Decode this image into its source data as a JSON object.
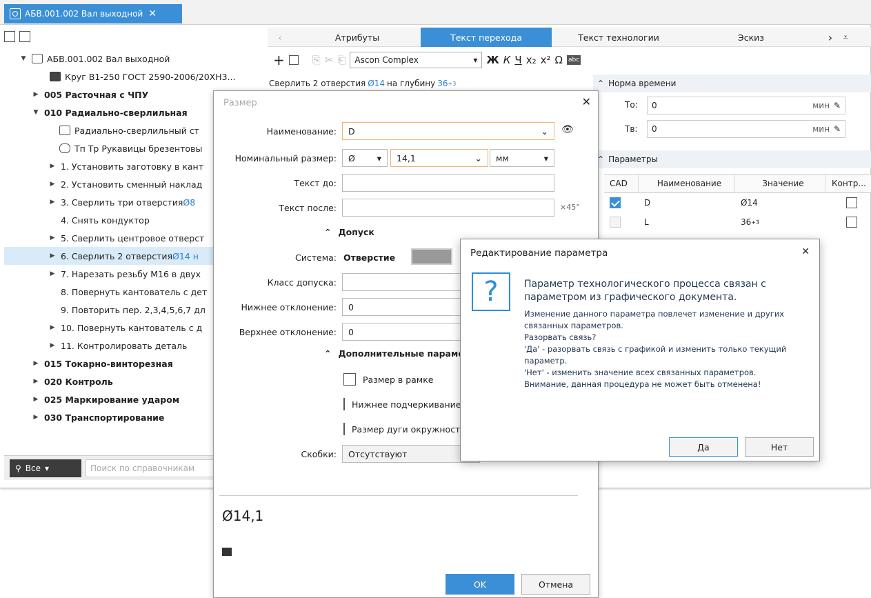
{
  "doc_tab": {
    "title": "АБВ.001.002 Вал выходной",
    "close": "✕"
  },
  "tree": {
    "root": "АБВ.001.002 Вал выходной",
    "material": "Круг В1-250 ГОСТ 2590-2006/20ХН3...",
    "items": [
      {
        "text": "005 Расточная с ЧПУ",
        "bold": true
      },
      {
        "text": "010 Радиально-сверлильная",
        "bold": true
      },
      {
        "text": "Радиально-сверлильный ст"
      },
      {
        "text": "Тп Тр Рукавицы брезентовы"
      },
      {
        "text": "1. Установить заготовку в кант"
      },
      {
        "text": "2. Установить сменный наклад"
      },
      {
        "text": "3. Сверлить три отверстия ",
        "blue": "Ø8"
      },
      {
        "text": "4. Снять кондуктор"
      },
      {
        "text": "5. Сверлить центровое отверст"
      },
      {
        "text": "6. Сверлить 2 отверстия ",
        "blue": "Ø14 н"
      },
      {
        "text": "7. Нарезать резьбу М16 в двух"
      },
      {
        "text": "8. Повернуть кантователь с дет"
      },
      {
        "text": "9. Повторить пер. 2,3,4,5,6,7 дл"
      },
      {
        "text": "10. Повернуть кантователь с д"
      },
      {
        "text": "11. Контролировать деталь"
      },
      {
        "text": "015 Токарно-винторезная",
        "bold": true
      },
      {
        "text": "020 Контроль",
        "bold": true
      },
      {
        "text": "025 Маркирование ударом",
        "bold": true
      },
      {
        "text": "030 Транспортирование",
        "bold": true
      }
    ],
    "search_scope": "Все",
    "search_placeholder": "Поиск по справочникам"
  },
  "right_tabs": [
    "Атрибуты",
    "Текст перехода",
    "Текст технологии",
    "Эскиз"
  ],
  "toolbar": {
    "font": "Ascon Complex",
    "bold": "Ж",
    "italic": "К",
    "underline": "Ч",
    "sub": "x₂",
    "sup": "x²",
    "omega": "Ω",
    "abc": "abc"
  },
  "transition_text": {
    "prefix": "Сверлить 2 отверстия ",
    "dia": "Ø14",
    "mid": " на глубину ",
    "depth": "36",
    "tol": "+3"
  },
  "norm": {
    "header": "Норма времени",
    "to_label": "То:",
    "to_value": "0",
    "to_unit": "мин",
    "tv_label": "Тв:",
    "tv_value": "0",
    "tv_unit": "мин"
  },
  "params": {
    "header": "Параметры",
    "columns": [
      "CAD",
      "Наименование",
      "Значение",
      "Контр..."
    ],
    "rows": [
      {
        "cad": true,
        "name": "D",
        "value": "Ø14",
        "tol": ""
      },
      {
        "cad": false,
        "name": "L",
        "value": "36",
        "tol": "+3"
      }
    ]
  },
  "size_dialog": {
    "title": "Размер",
    "name_label": "Наименование:",
    "name_value": "D",
    "nominal_label": "Номинальный размер:",
    "symbol": "Ø",
    "nominal_value": "14,1",
    "unit": "мм",
    "before_label": "Текст до:",
    "after_label": "Текст после:",
    "x45": "×45°",
    "tolerance_header": "Допуск",
    "system_label": "Система:",
    "system_value": "Отверстие",
    "class_label": "Класс допуска:",
    "lower_label": "Нижнее отклонение:",
    "lower_value": "0",
    "upper_label": "Верхнее отклонение:",
    "upper_value": "0",
    "extra_header": "Дополнительные параметры",
    "cb1": "Размер в рамке",
    "cb2": "Нижнее подчеркивание",
    "cb3": "Размер дуги окружности",
    "brackets_label": "Скобки:",
    "brackets_value": "Отсутствуют",
    "preview": "Ø14,1",
    "ok": "OK",
    "cancel": "Отмена"
  },
  "msg": {
    "title": "Редактирование параметра",
    "headline": "Параметр технологического процесса связан с параметром из графического документа.",
    "body": "Изменение данного параметра повлечет изменение и других связанных параметров.\nРазорвать связь?\n'Да' - разорвать связь с графикой и изменить только текущий параметр.\n'Нет' - изменить значение всех связанных параметров.\nВнимание, данная процедура не может быть отменена!",
    "yes": "Да",
    "no": "Нет",
    "close": "✕",
    "icon": "?"
  }
}
